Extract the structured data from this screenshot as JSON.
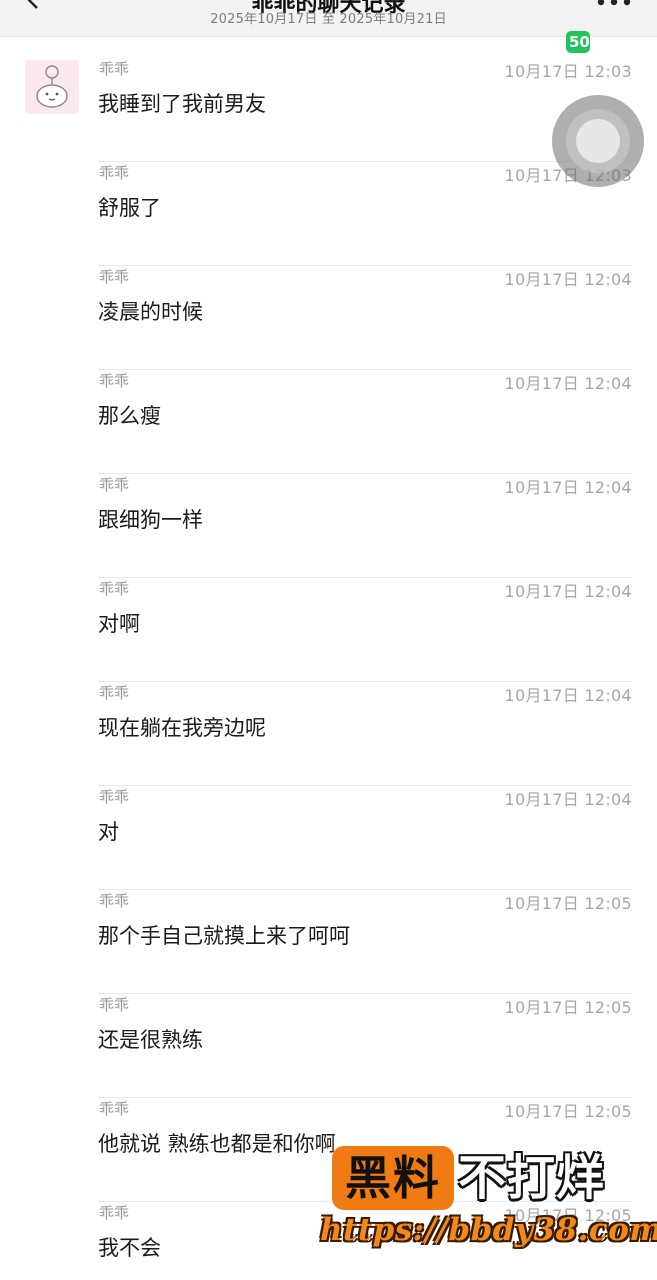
{
  "header": {
    "title": "乖乖的聊天记录",
    "date_range": "2025年10月17日 至 2025年10月21日"
  },
  "status_badge": "50",
  "messages": [
    {
      "sender": "乖乖",
      "time": "10月17日 12:03",
      "text": "我睡到了我前男友"
    },
    {
      "sender": "乖乖",
      "time": "10月17日 12:03",
      "text": "舒服了"
    },
    {
      "sender": "乖乖",
      "time": "10月17日 12:04",
      "text": "凌晨的时候"
    },
    {
      "sender": "乖乖",
      "time": "10月17日 12:04",
      "text": "那么瘦"
    },
    {
      "sender": "乖乖",
      "time": "10月17日 12:04",
      "text": "跟细狗一样"
    },
    {
      "sender": "乖乖",
      "time": "10月17日 12:04",
      "text": "对啊"
    },
    {
      "sender": "乖乖",
      "time": "10月17日 12:04",
      "text": "现在躺在我旁边呢"
    },
    {
      "sender": "乖乖",
      "time": "10月17日 12:04",
      "text": "对"
    },
    {
      "sender": "乖乖",
      "time": "10月17日 12:05",
      "text": "那个手自己就摸上来了呵呵"
    },
    {
      "sender": "乖乖",
      "time": "10月17日 12:05",
      "text": "还是很熟练"
    },
    {
      "sender": "乖乖",
      "time": "10月17日 12:05",
      "text": "他就说 熟练也都是和你啊"
    },
    {
      "sender": "乖乖",
      "time": "10月17日 12:05",
      "text": "我不会"
    }
  ],
  "watermark": {
    "box_text": "黑料",
    "side_text": "不打烊",
    "url": "https://bbdy38.com"
  },
  "colors": {
    "watermark_orange": "#f07a13",
    "badge_green": "#21c35a",
    "time_gray": "#a6a6a6"
  }
}
